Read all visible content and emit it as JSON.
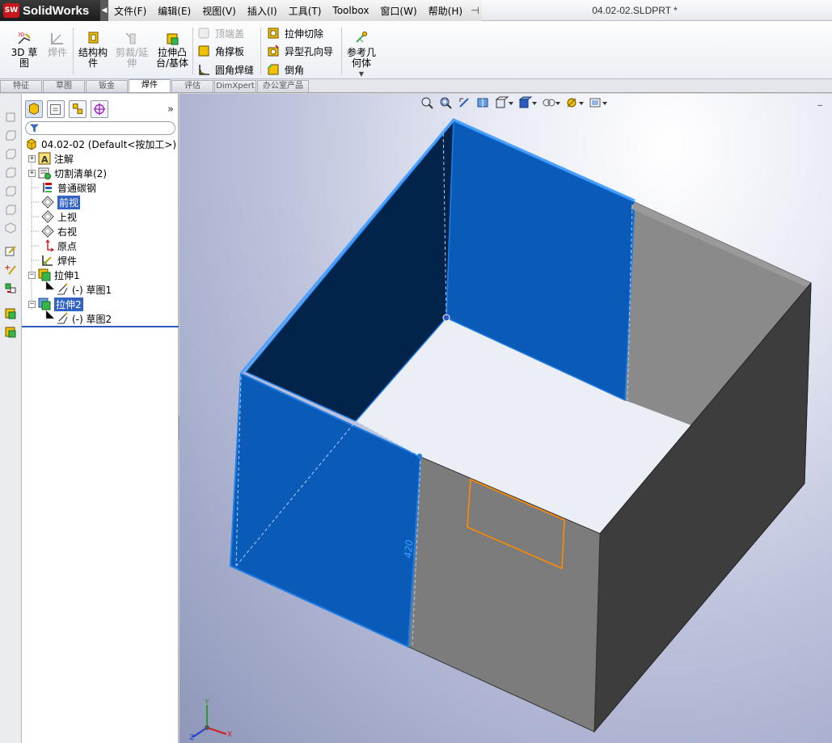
{
  "app": {
    "logo_badge": "SW",
    "name": "SolidWorks",
    "document_title": "04.02-02.SLDPRT *"
  },
  "menu": [
    "文件(F)",
    "编辑(E)",
    "视图(V)",
    "插入(I)",
    "工具(T)",
    "Toolbox",
    "窗口(W)",
    "帮助(H)"
  ],
  "ribbon": {
    "sketch3d": "3D 草图",
    "weldment": "焊件",
    "structural_member": "结构构件",
    "trim_extend": "剪裁/延伸",
    "extrude_boss": "拉伸凸台/基体",
    "end_cap": "顶端盖",
    "gusset": "角撑板",
    "fillet_bead": "圆角焊缝",
    "extruded_cut": "拉伸切除",
    "hole_wizard": "异型孔向导",
    "chamfer": "倒角",
    "ref_geometry": "参考几何体"
  },
  "tabs": [
    "特征",
    "草图",
    "钣金",
    "焊件",
    "评估",
    "DimXpert",
    "办公室产品"
  ],
  "active_tab": "焊件",
  "feature_tree": {
    "filter_placeholder": "",
    "more": "»",
    "root": "04.02-02  (Default<按加工>)",
    "items": [
      {
        "label": "注解"
      },
      {
        "label": "切割清单(2)"
      },
      {
        "label": "普通碳钢"
      },
      {
        "label": "前视"
      },
      {
        "label": "上视"
      },
      {
        "label": "右视"
      },
      {
        "label": "原点"
      },
      {
        "label": "焊件"
      },
      {
        "label": "拉伸1"
      },
      {
        "label": "(-) 草图1"
      },
      {
        "label": "拉伸2"
      },
      {
        "label": "(-) 草图2"
      }
    ],
    "expanders": {
      "plus": "+",
      "minus": "−"
    }
  },
  "viewport": {
    "minimize": "_",
    "dimension": "420",
    "triad": {
      "x": "X",
      "y": "Y",
      "z": "Z"
    }
  },
  "colors": {
    "selection_blue": "#0a5bb8",
    "model_gray": "#7c7c7c",
    "sketch_orange": "#ff8a00"
  }
}
